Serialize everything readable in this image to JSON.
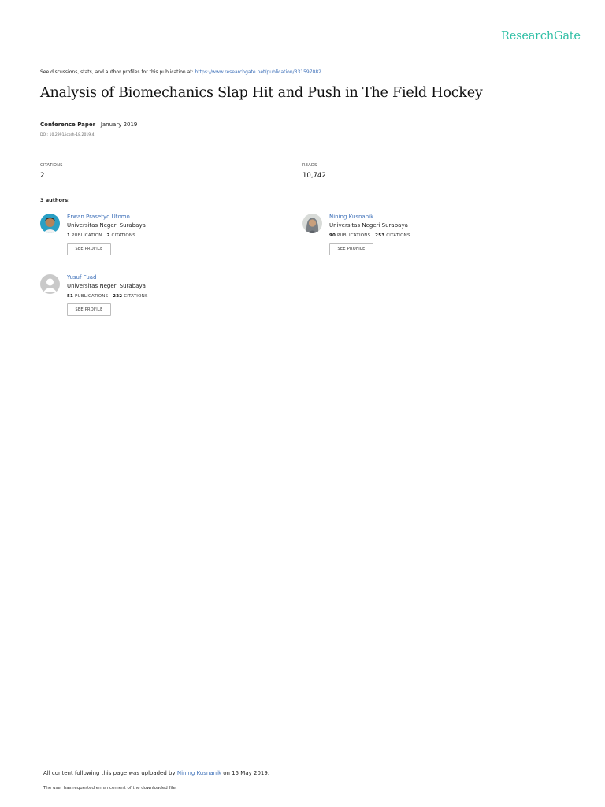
{
  "brand": "ResearchGate",
  "discussion": {
    "prefix": "See discussions, stats, and author profiles for this publication at: ",
    "link": "https://www.researchgate.net/publication/331597082"
  },
  "title": "Analysis of Biomechanics Slap Hit and Push in The Field Hockey",
  "meta": {
    "type": "Conference Paper",
    "separator": " · ",
    "date": "January 2019"
  },
  "doi": "DOI: 10.2991/icssh-18.2019.4",
  "stats": {
    "citations": {
      "label": "CITATIONS",
      "value": "2"
    },
    "reads": {
      "label": "READS",
      "value": "10,742"
    }
  },
  "authors_heading": "3 authors:",
  "authors": [
    {
      "name": "Erwan Prasetyo Utomo",
      "institution": "Universitas Negeri Surabaya",
      "publications_count": "1",
      "publications_label": "PUBLICATION",
      "citations_count": "2",
      "citations_label": "CITATIONS",
      "button": "SEE PROFILE"
    },
    {
      "name": "Nining Kusnanik",
      "institution": "Universitas Negeri Surabaya",
      "publications_count": "90",
      "publications_label": "PUBLICATIONS",
      "citations_count": "253",
      "citations_label": "CITATIONS",
      "button": "SEE PROFILE"
    },
    {
      "name": "Yusuf Fuad",
      "institution": "Universitas Negeri Surabaya",
      "publications_count": "51",
      "publications_label": "PUBLICATIONS",
      "citations_count": "222",
      "citations_label": "CITATIONS",
      "button": "SEE PROFILE"
    }
  ],
  "footer": {
    "prefix": "All content following this page was uploaded by ",
    "uploader": "Nining Kusnanik",
    "suffix": " on 15 May 2019.",
    "note": "The user has requested enhancement of the downloaded file."
  },
  "colors": {
    "brand": "#2fbfa5",
    "link": "#3c6fb8"
  }
}
